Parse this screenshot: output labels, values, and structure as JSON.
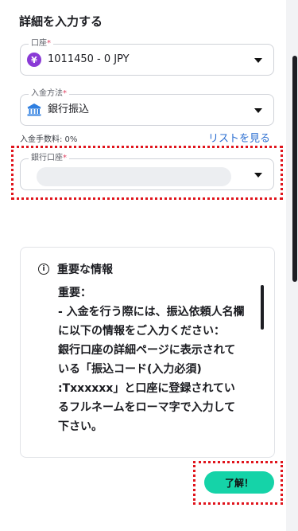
{
  "page_title": "詳細を入力する",
  "account_field": {
    "label": "口座",
    "required_mark": "*",
    "value": "1011450 - 0 JPY",
    "icon_glyph": "¥",
    "icon": "yen-icon"
  },
  "method_field": {
    "label": "入金方法",
    "required_mark": "*",
    "value": "銀行振込",
    "icon": "bank-icon"
  },
  "fee_text": "入金手数料: 0%",
  "list_link": "リストを見る",
  "bank_field": {
    "label": "銀行口座",
    "required_mark": "*",
    "value": ""
  },
  "info_card": {
    "title": "重要な情報",
    "icon_glyph": "i",
    "body": "重要：\n- 入金を行う際には、振込依頼人名欄に以下の情報をご入力ください：\n銀行口座の詳細ページに表示されている「振込コード(入力必須) :Txxxxxx」と口座に登録されているフルネームをローマ字で入力して下さい。"
  },
  "ok_button": "了解！",
  "colors": {
    "accent": "#15d3a8",
    "link": "#2c6fd1",
    "required": "#e04060",
    "highlight": "#e0141c"
  }
}
